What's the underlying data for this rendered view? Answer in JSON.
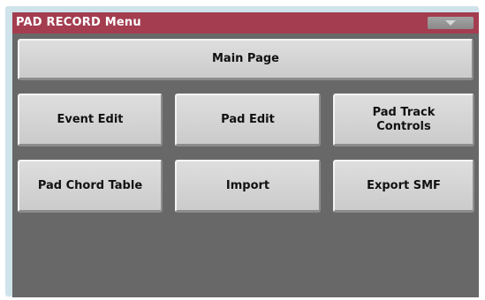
{
  "window": {
    "title": "PAD RECORD Menu",
    "menu_icon": "triangle-down",
    "colors": {
      "title_bar": "#a43d50",
      "screen": "#686868",
      "frame": "#cfe3ea",
      "button": "#d8d8d8"
    }
  },
  "buttons": {
    "main_page": "Main Page",
    "event_edit": "Event Edit",
    "pad_edit": "Pad Edit",
    "pad_track_controls": "Pad Track\nControls",
    "pad_chord_table": "Pad Chord Table",
    "import": "Import",
    "export_smf": "Export SMF"
  }
}
